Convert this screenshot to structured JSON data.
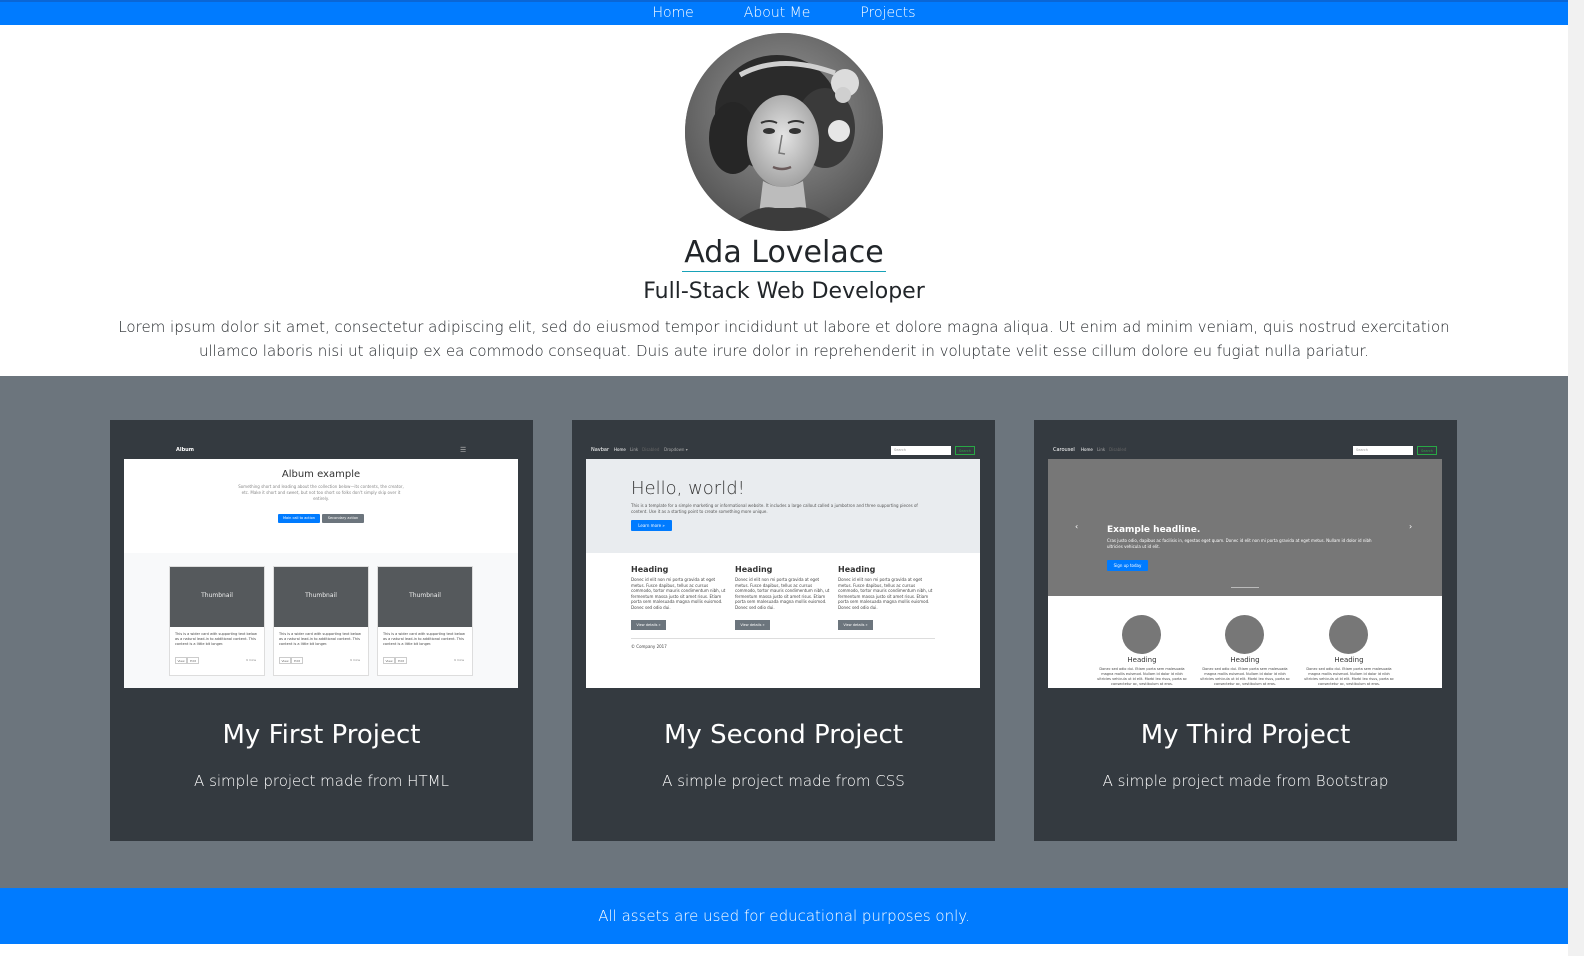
{
  "nav": {
    "items": [
      {
        "label": "Home"
      },
      {
        "label": "About Me"
      },
      {
        "label": "Projects"
      }
    ]
  },
  "hero": {
    "name": "Ada Lovelace",
    "role": "Full-Stack Web Developer",
    "bio": "Lorem ipsum dolor sit amet, consectetur adipiscing elit, sed do eiusmod tempor incididunt ut labore et dolore magna aliqua. Ut enim ad minim veniam, quis nostrud exercitation ullamco laboris nisi ut aliquip ex ea commodo consequat. Duis aute irure dolor in reprehenderit in voluptate velit esse cillum dolore eu fugiat nulla pariatur."
  },
  "projects": [
    {
      "title": "My First Project",
      "text": "A simple project made from HTML",
      "thumb": {
        "brand": "Album",
        "heading": "Album example",
        "lead": "Something short and leading about the collection below—its contents, the creator, etc. Make it short and sweet, but not too short so folks don't simply skip over it entirely.",
        "btn_primary": "Main call to action",
        "btn_secondary": "Secondary action",
        "thumb_label": "Thumbnail",
        "card_text": "This is a wider card with supporting text below as a natural lead-in to additional content. This content is a little bit longer.",
        "view": "View",
        "edit": "Edit",
        "mins": "9 mins"
      }
    },
    {
      "title": "My Second Project",
      "text": "A simple project made from CSS",
      "thumb": {
        "brand": "Navbar",
        "nav_home": "Home",
        "nav_link": "Link",
        "nav_disabled": "Disabled",
        "nav_dropdown": "Dropdown ▾",
        "search_placeholder": "Search",
        "search_btn": "Search",
        "jumbo": "Hello, world!",
        "jumbo_text": "This is a template for a simple marketing or informational website. It includes a large callout called a jumbotron and three supporting pieces of content. Use it as a starting point to create something more unique.",
        "learn_more": "Learn more »",
        "heading": "Heading",
        "col_text": "Donec id elit non mi porta gravida at eget metus. Fusce dapibus, tellus ac cursus commodo, tortor mauris condimentum nibh, ut fermentum massa justo sit amet risus. Etiam porta sem malesuada magna mollis euismod. Donec sed odio dui.",
        "view_details": "View details »",
        "copyright": "© Company 2017"
      }
    },
    {
      "title": "My Third Project",
      "text": "A simple project made from Bootstrap",
      "thumb": {
        "brand": "Carousel",
        "nav_home": "Home",
        "nav_link": "Link",
        "nav_disabled": "Disabled",
        "search_placeholder": "Search",
        "search_btn": "Search",
        "headline": "Example headline.",
        "headline_text": "Cras justo odio, dapibus ac facilisis in, egestas eget quam. Donec id elit non mi porta gravida at eget metus. Nullam id dolor id nibh ultricies vehicula ut id elit.",
        "signup": "Sign up today",
        "heading": "Heading",
        "col_text": "Donec sed odio dui. Etiam porta sem malesuada magna mollis euismod. Nullam id dolor id nibh ultricies vehicula ut id elit. Morbi leo risus, porta ac consectetur ac, vestibulum at eros."
      }
    }
  ],
  "footer": {
    "text": "All assets are used for educational purposes only."
  },
  "colors": {
    "primary": "#007bff",
    "section_bg": "#6c757d",
    "card_bg": "#343a40",
    "underline": "#17a2b8"
  }
}
